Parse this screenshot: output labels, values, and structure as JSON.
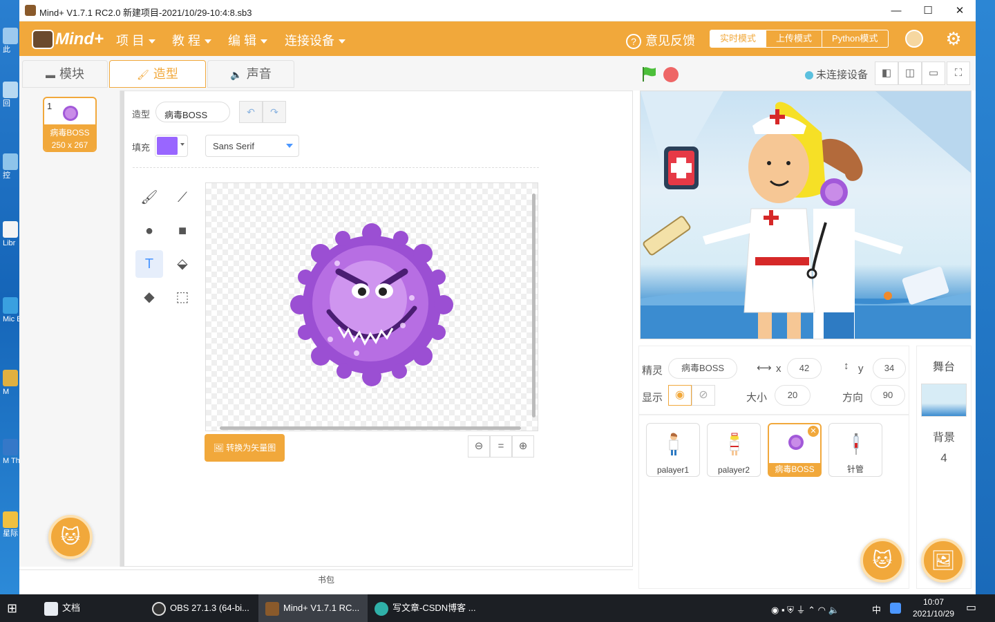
{
  "window": {
    "title": "Mind+ V1.7.1 RC2.0   新建项目-2021/10/29-10:4:8.sb3",
    "minimize": "—",
    "maximize": "☐",
    "close": "✕"
  },
  "menubar": {
    "logo": "Mind+",
    "items": [
      "项 目",
      "教 程",
      "编 辑",
      "连接设备"
    ],
    "feedback": "意见反馈",
    "modes": [
      "实时模式",
      "上传模式",
      "Python模式"
    ],
    "accent": "#f1a83b"
  },
  "tabs": [
    "模块",
    "造型",
    "声音"
  ],
  "stage_controls": {
    "connection_status": "未连接设备"
  },
  "costume_list": [
    {
      "index": "1",
      "name": "病毒BOSS",
      "size": "250 x 267"
    }
  ],
  "paint_editor": {
    "costume_label": "造型",
    "costume_name": "病毒BOSS",
    "fill_label": "填充",
    "fill_color": "#9966ff",
    "font": "Sans Serif",
    "convert_button": "转换为矢量图",
    "zoom_reset": "="
  },
  "backpack": "书包",
  "sprite_info": {
    "sprite_label": "精灵",
    "sprite_name": "病毒BOSS",
    "x_label": "x",
    "x": "42",
    "y_label": "y",
    "y": "34",
    "show_label": "显示",
    "size_label": "大小",
    "size": "20",
    "direction_label": "方向",
    "direction": "90"
  },
  "sprites": [
    {
      "name": "palayer1"
    },
    {
      "name": "palayer2"
    },
    {
      "name": "病毒BOSS",
      "selected": true
    },
    {
      "name": "针管"
    }
  ],
  "stage_panel": {
    "title": "舞台",
    "backdrop_label": "背景",
    "backdrop_count": "4"
  },
  "desktop_icons": [
    "此",
    "回",
    "控",
    "Libr",
    "Mic Edg",
    "M",
    "M Thu",
    "星际"
  ],
  "taskbar": {
    "items": [
      "文档",
      "OBS 27.1.3 (64-bi...",
      "Mind+ V1.7.1 RC...",
      "写文章-CSDN博客 ..."
    ],
    "time": "10:07",
    "date": "2021/10/29",
    "ime": "中"
  }
}
